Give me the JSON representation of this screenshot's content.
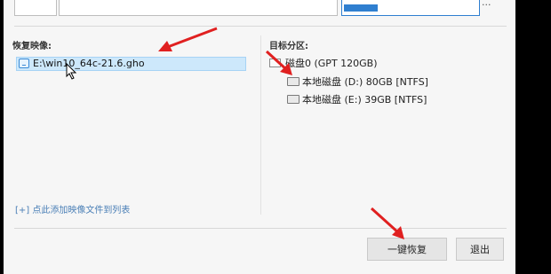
{
  "top": {
    "box_a_text": "",
    "box_b_text": "",
    "box_c_text": "",
    "right_link": "..."
  },
  "restore_image": {
    "label": "恢复映像:",
    "items": [
      {
        "path": "E:\\win10_64c-21.6.gho",
        "selected": true
      }
    ],
    "add_link": "[+] 点此添加映像文件到列表"
  },
  "target_partition": {
    "label": "目标分区:",
    "disk": "磁盘0 (GPT 120GB)",
    "partitions": [
      {
        "label": "本地磁盘 (D:) 80GB [NTFS]"
      },
      {
        "label": "本地磁盘 (E:) 39GB [NTFS]"
      }
    ]
  },
  "buttons": {
    "restore": "一键恢复",
    "exit": "退出"
  },
  "colors": {
    "annotation_arrow": "#e02020",
    "selection": "#cde8fb",
    "accent": "#2f7fd0"
  }
}
